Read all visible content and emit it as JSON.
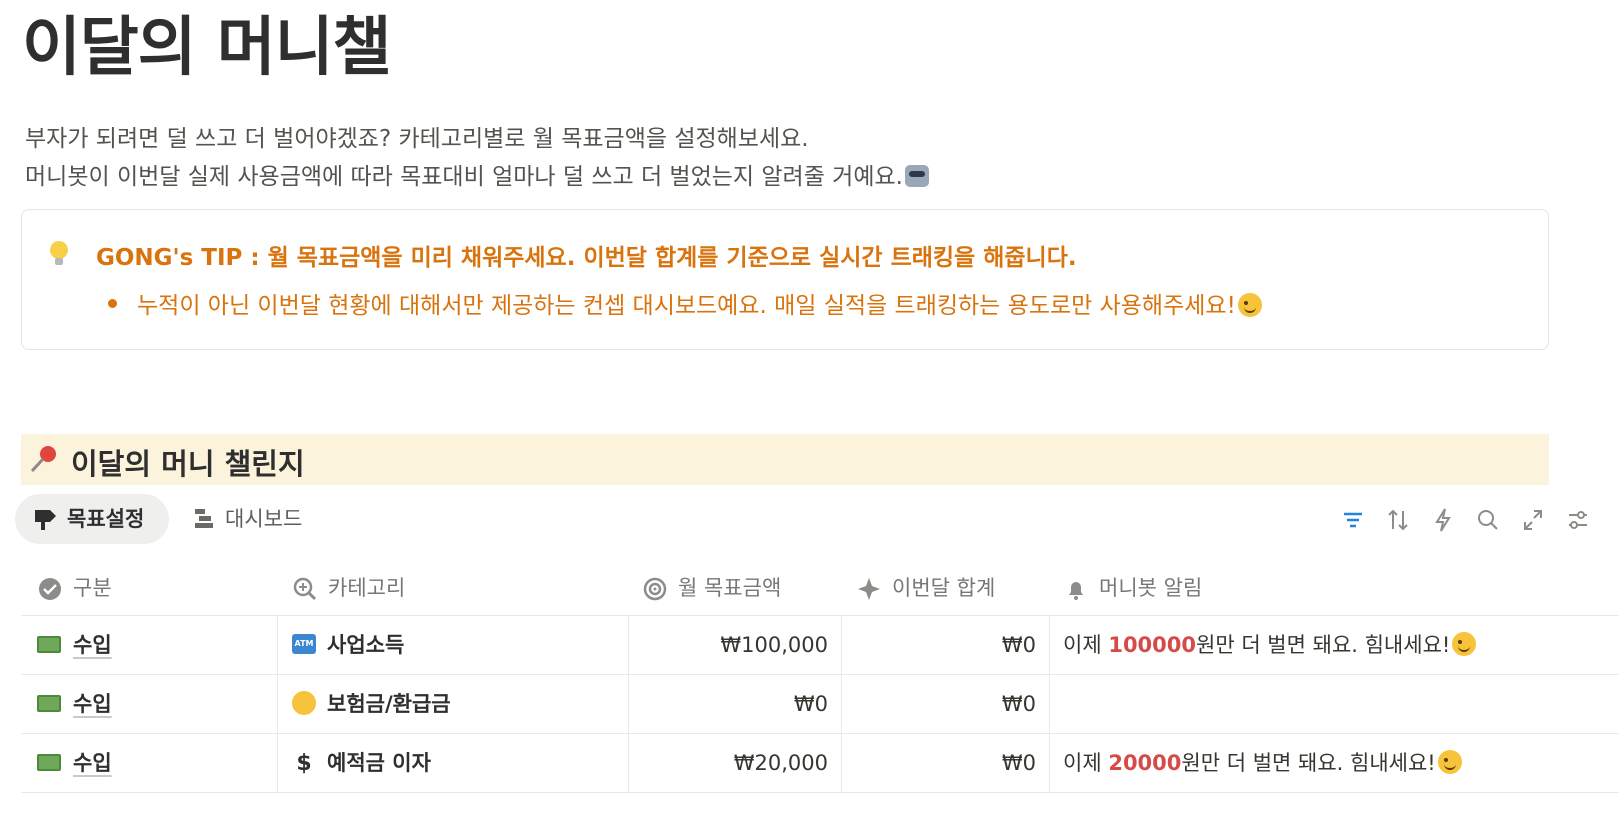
{
  "page": {
    "title": "이달의 머니챌",
    "description": [
      "부자가 되려면 덜 쓰고 더 벌어야겠죠? 카테고리별로 월 목표금액을 설정해보세요.",
      "머니봇이 이번달 실제 사용금액에 따라 목표대비 얼마나 덜 쓰고 더 벌었는지 알려줄 거예요."
    ]
  },
  "callout": {
    "icon": "lightbulb-icon",
    "tip": "GONG's TIP : 월 목표금액을 미리 채워주세요. 이번달 합계를 기준으로 실시간 트래킹을 해줍니다.",
    "bullet": "누적이 아닌 이번달 현황에 대해서만 제공하는 컨셉 대시보드예요. 매일 실적을 트래킹하는 용도로만 사용해주세요!"
  },
  "section": {
    "icon": "pushpin-icon",
    "title": "이달의 머니 챌린지"
  },
  "tabs": [
    {
      "label": "목표설정",
      "icon": "signpost-icon",
      "active": true
    },
    {
      "label": "대시보드",
      "icon": "timeline-icon",
      "active": false
    }
  ],
  "toolbar": [
    "filter-icon",
    "sort-icon",
    "automation-icon",
    "search-icon",
    "expand-icon",
    "settings-icon"
  ],
  "table": {
    "columns": [
      {
        "label": "구분",
        "icon": "check-circle-icon"
      },
      {
        "label": "카테고리",
        "icon": "zoom-in-icon"
      },
      {
        "label": "월 목표금액",
        "icon": "target-icon"
      },
      {
        "label": "이번달 합계",
        "icon": "sparkle-icon"
      },
      {
        "label": "머니봇 알림",
        "icon": "bell-icon"
      }
    ],
    "rows": [
      {
        "type": "수입",
        "category": "사업소득",
        "category_icon": "atm-icon",
        "target": "₩100,000",
        "total": "₩0",
        "alert_pre": "이제 ",
        "alert_amount": "100000",
        "alert_post": "원만 더 벌면 돼요. 힘내세요!"
      },
      {
        "type": "수입",
        "category": "보험금/환급금",
        "category_icon": "halo-face-icon",
        "target": "₩0",
        "total": "₩0",
        "alert_pre": "",
        "alert_amount": "",
        "alert_post": ""
      },
      {
        "type": "수입",
        "category": "예적금 이자",
        "category_icon": "dollar-icon",
        "target": "₩20,000",
        "total": "₩0",
        "alert_pre": "이제 ",
        "alert_amount": "20000",
        "alert_post": "원만 더 벌면 돼요. 힘내세요!"
      }
    ]
  },
  "colors": {
    "tip": "#d9730d",
    "section_bg": "#fbf3db",
    "alert_amount": "#d44c47",
    "active_tool": "#2383e2"
  }
}
